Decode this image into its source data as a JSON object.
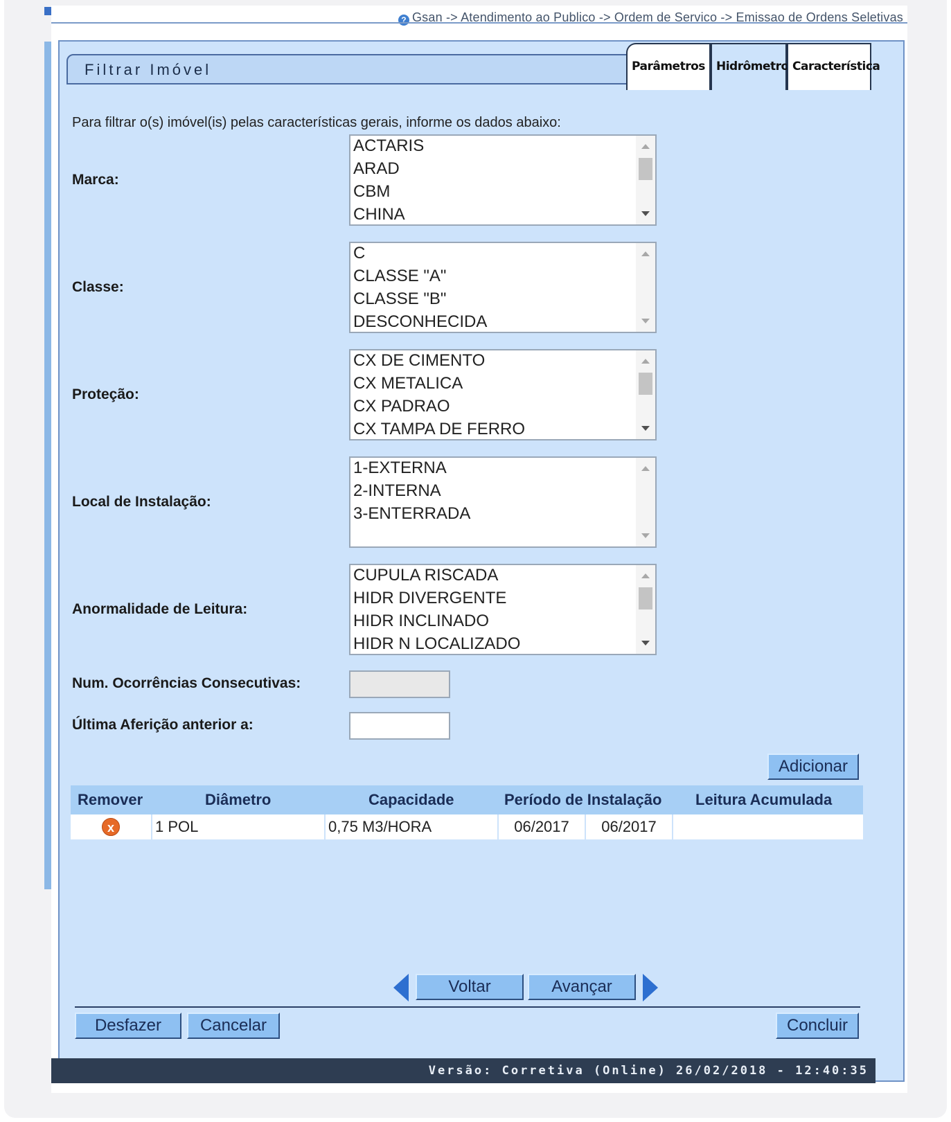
{
  "breadcrumb": "Gsan -> Atendimento ao Publico -> Ordem de Servico -> Emissao de Ordens Seletivas",
  "title": "Filtrar Imóvel",
  "tabs": [
    "Parâmetros",
    "Hidrômetro",
    "Característica"
  ],
  "active_tab": "Hidrômetro",
  "intro": "Para filtrar o(s) imóvel(is) pelas características gerais, informe os dados abaixo:",
  "fields": {
    "marca": {
      "label": "Marca:",
      "options": [
        "ACTARIS",
        "ARAD",
        "CBM",
        "CHINA"
      ]
    },
    "classe": {
      "label": "Classe:",
      "options": [
        "C",
        "CLASSE \"A\"",
        "CLASSE \"B\"",
        "DESCONHECIDA"
      ]
    },
    "protecao": {
      "label": "Proteção:",
      "options": [
        "CX DE CIMENTO",
        "CX METALICA",
        "CX PADRAO",
        "CX TAMPA DE FERRO"
      ]
    },
    "local": {
      "label": "Local de Instalação:",
      "options": [
        "1-EXTERNA",
        "2-INTERNA",
        "3-ENTERRADA",
        ""
      ]
    },
    "anormalidade": {
      "label": "Anormalidade de Leitura:",
      "options": [
        "CUPULA RISCADA",
        "HIDR DIVERGENTE",
        "HIDR INCLINADO",
        "HIDR N LOCALIZADO"
      ]
    },
    "ocorrencias": {
      "label": "Num. Ocorrências Consecutivas:",
      "value": ""
    },
    "afericao": {
      "label": "Última Aferição anterior a:",
      "value": ""
    }
  },
  "buttons": {
    "adicionar": "Adicionar",
    "voltar": "Voltar",
    "avancar": "Avançar",
    "desfazer": "Desfazer",
    "cancelar": "Cancelar",
    "concluir": "Concluir"
  },
  "table": {
    "headers": [
      "Remover",
      "Diâmetro",
      "Capacidade",
      "Período de Instalação",
      "Leitura Acumulada"
    ],
    "rows": [
      {
        "diametro": "1 POL",
        "capacidade": "0,75 M3/HORA",
        "periodo_inicio": "06/2017",
        "periodo_fim": "06/2017",
        "leitura": ""
      }
    ]
  },
  "version": "Versão: Corretiva (Online) 26/02/2018 - 12:40:35",
  "colors": {
    "panel": "#cde3fb",
    "button": "#8ec0f2",
    "version_bar": "#2e3d52",
    "remove_icon": "#e66a28"
  }
}
